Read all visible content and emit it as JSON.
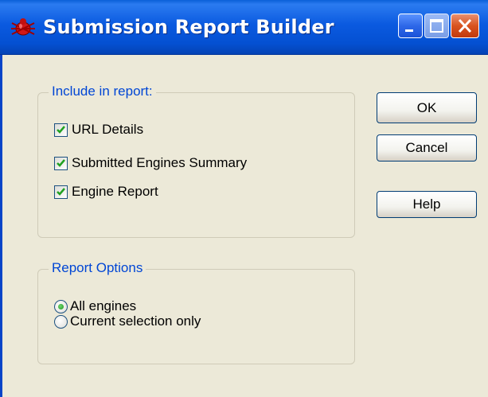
{
  "window": {
    "title": "Submission Report Builder",
    "controls": {
      "minimize": "minimize",
      "maximize": "maximize",
      "close": "close"
    }
  },
  "include_group": {
    "legend": "Include in report:",
    "items": [
      {
        "label": "URL Details",
        "checked": true
      },
      {
        "label": "Submitted Engines Summary",
        "checked": true
      },
      {
        "label": "Engine Report",
        "checked": true
      }
    ]
  },
  "options_group": {
    "legend": "Report Options",
    "items": [
      {
        "label": "All engines",
        "selected": true
      },
      {
        "label": "Current selection only",
        "selected": false
      }
    ]
  },
  "buttons": {
    "ok": "OK",
    "cancel": "Cancel",
    "help": "Help"
  },
  "colors": {
    "titlebar": "#0450d2",
    "legend_text": "#0046d5",
    "dialog_bg": "#ece9d8",
    "check_mark": "#21a121",
    "radio_dot": "#1f9a1f"
  }
}
